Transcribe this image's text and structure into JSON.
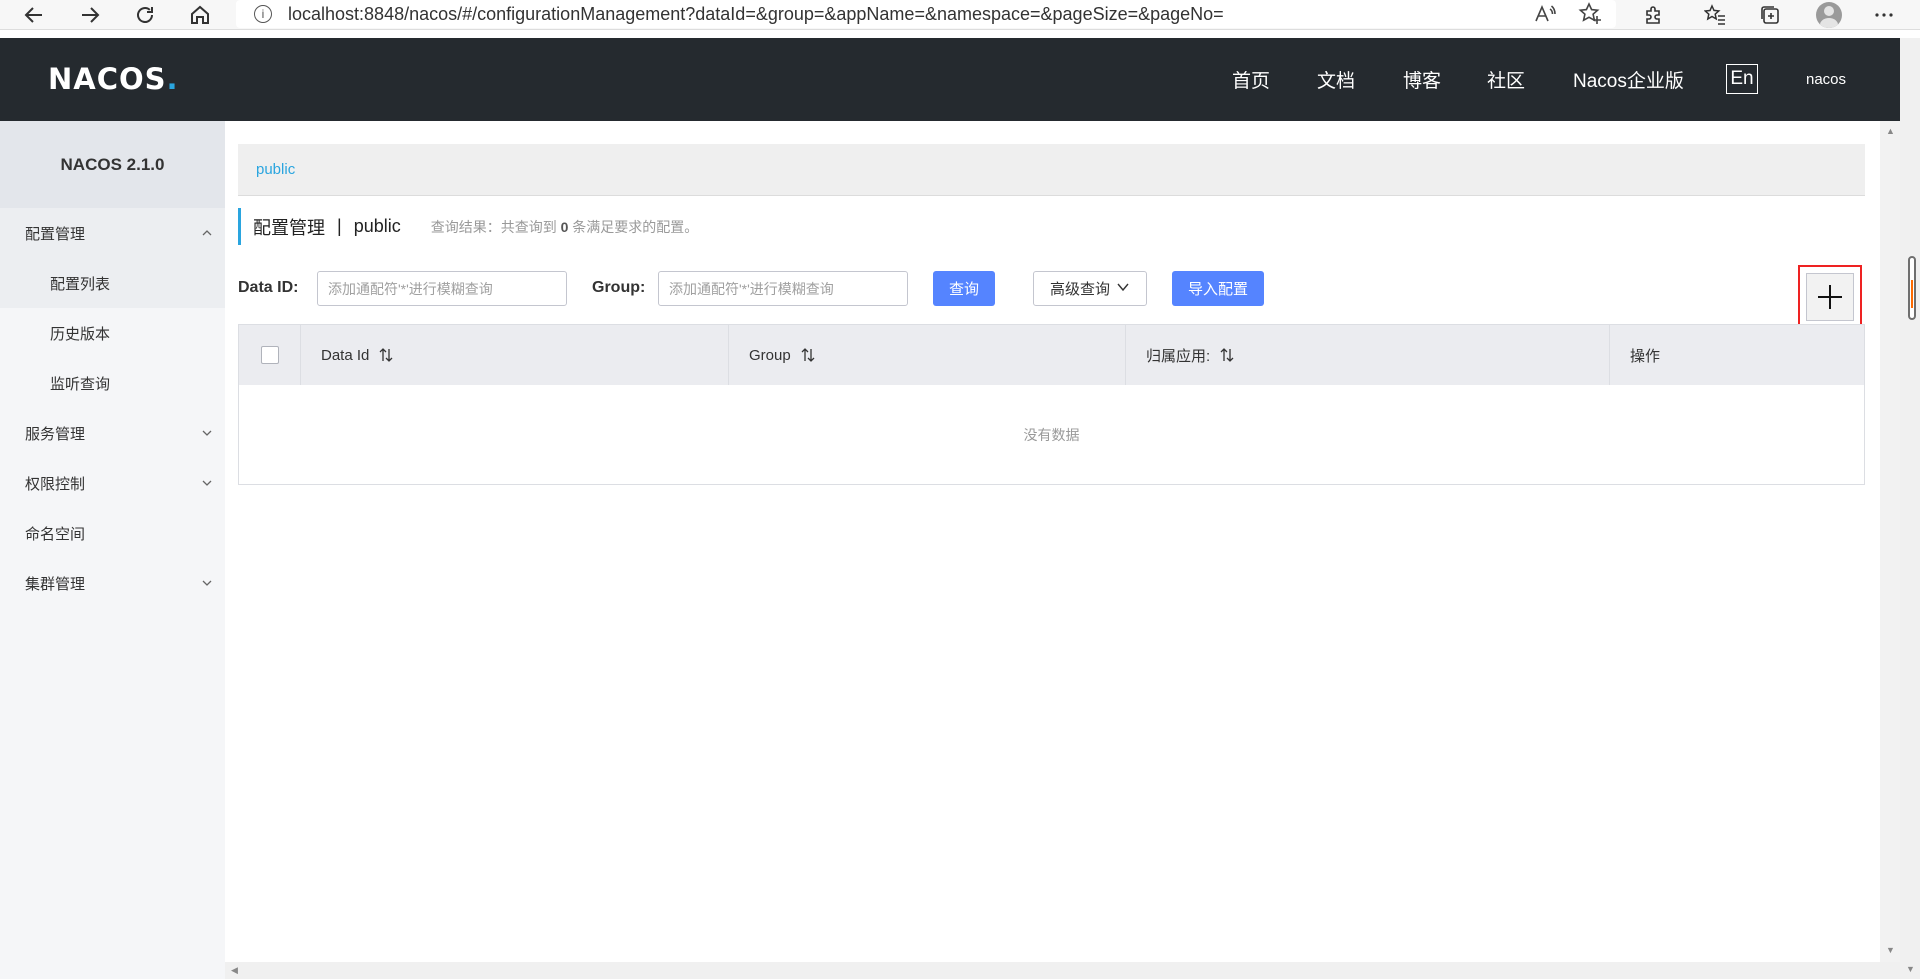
{
  "browser": {
    "url": "localhost:8848/nacos/#/configurationManagement?dataId=&group=&appName=&namespace=&pageSize=&pageNo=",
    "back_icon": "back-arrow-icon",
    "forward_icon": "forward-arrow-icon",
    "refresh_icon": "refresh-icon",
    "home_icon": "home-icon"
  },
  "header": {
    "logo": "NACOS.",
    "nav": [
      "首页",
      "文档",
      "博客",
      "社区",
      "Nacos企业版"
    ],
    "lang": "En",
    "user": "nacos"
  },
  "sidebar": {
    "title": "NACOS 2.1.0",
    "groups": [
      {
        "label": "配置管理",
        "expanded": true,
        "items": [
          "配置列表",
          "历史版本",
          "监听查询"
        ]
      },
      {
        "label": "服务管理",
        "expanded": false
      },
      {
        "label": "权限控制",
        "expanded": false
      },
      {
        "label": "命名空间",
        "expanded": false
      },
      {
        "label": "集群管理",
        "expanded": false
      }
    ]
  },
  "breadcrumb": {
    "namespace": "public"
  },
  "page_title": {
    "main": "配置管理",
    "separator": "|",
    "namespace": "public",
    "query_prefix": "查询结果：共查询到",
    "query_count": "0",
    "query_suffix": "条满足要求的配置。"
  },
  "filters": {
    "data_id_label": "Data ID:",
    "data_id_placeholder": "添加通配符'*'进行模糊查询",
    "group_label": "Group:",
    "group_placeholder": "添加通配符'*'进行模糊查询",
    "search_button": "查询",
    "advanced_button": "高级查询",
    "import_button": "导入配置",
    "add_icon": "plus-icon"
  },
  "table": {
    "columns": [
      "Data Id",
      "Group",
      "归属应用:",
      "操作"
    ],
    "empty_text": "没有数据"
  },
  "colors": {
    "header_bg": "#252a2f",
    "accent": "#2aa5df",
    "primary_button": "#5584ff",
    "highlight_border": "#e22222"
  }
}
